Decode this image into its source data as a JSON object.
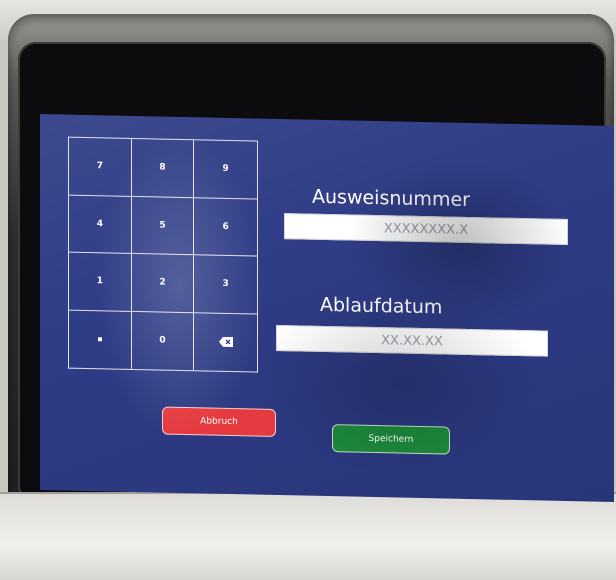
{
  "keypad": {
    "keys": [
      {
        "label": "7"
      },
      {
        "label": "8"
      },
      {
        "label": "9"
      },
      {
        "label": "4"
      },
      {
        "label": "5"
      },
      {
        "label": "6"
      },
      {
        "label": "1"
      },
      {
        "label": "2"
      },
      {
        "label": "3"
      },
      {
        "label": "",
        "icon": "decimal-point-icon"
      },
      {
        "label": "0"
      },
      {
        "label": "",
        "icon": "backspace-icon"
      }
    ]
  },
  "form": {
    "id_label": "Ausweisnummer",
    "id_placeholder": "XXXXXXXX.X",
    "expiry_label": "Ablaufdatum",
    "expiry_placeholder": "XX.XX.XX"
  },
  "buttons": {
    "abort_label": "Abbruch",
    "save_label": "Speichern"
  },
  "colors": {
    "screen_bg": "#2f3c86",
    "abort": "#e53a3f",
    "save": "#1d8a3c"
  }
}
